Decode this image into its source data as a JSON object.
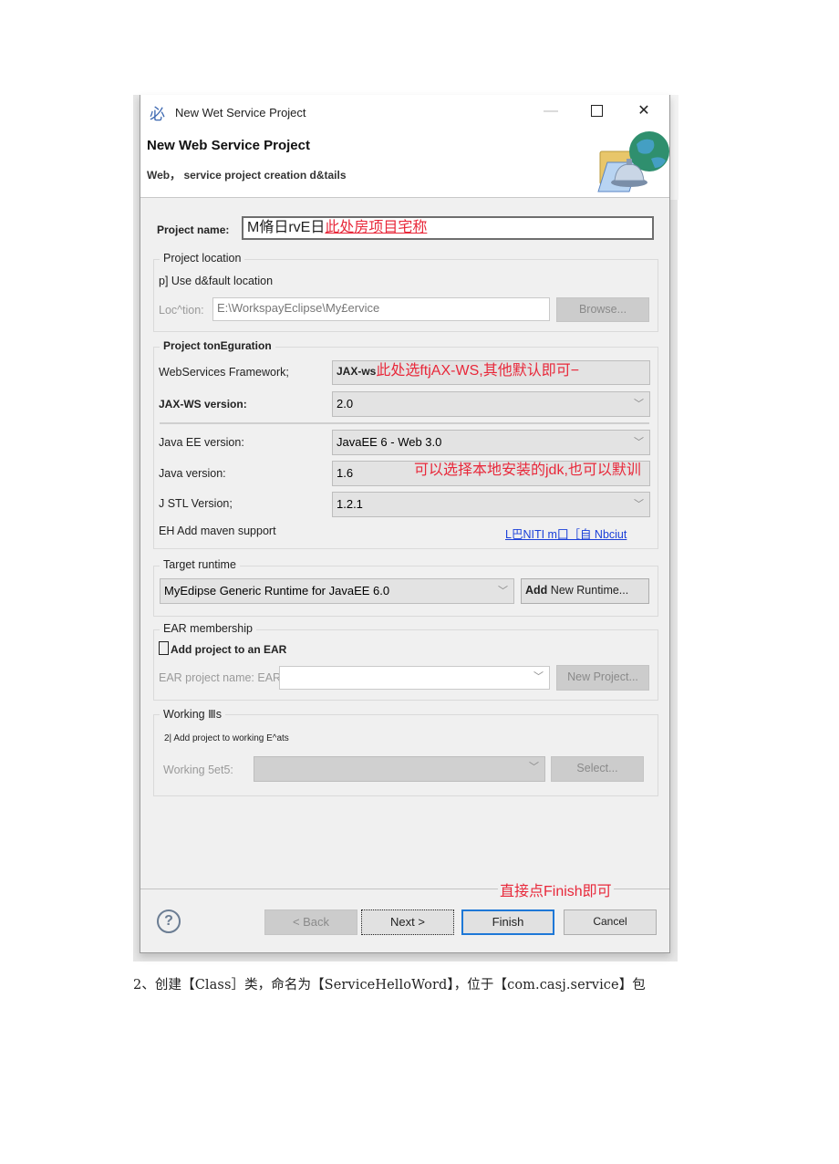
{
  "window": {
    "icon_glyph": "必",
    "title": "New Wet Service Project",
    "minimize_glyph": "—",
    "close_glyph": "✕"
  },
  "banner": {
    "title": "New Web Service Project",
    "subtitle": "Web， service project creation d&tails"
  },
  "project_name": {
    "label": "Project name: ",
    "value": "M脩日rvE日",
    "annotation": "此处房项目宅称"
  },
  "project_location": {
    "group_title": "Project location",
    "use_default_checkbox": "p] Use d&fault location",
    "location_label": "Loc^tion: ",
    "location_value": "E:\\WorkspayEclipse\\My£ervice",
    "browse_button": "Browse..."
  },
  "project_configuration": {
    "group_title": "Project tonEguration",
    "framework_label": "WebServices Framework;",
    "framework_value": "JAX-ws",
    "framework_annotation": "此处选ftjAX-WS,其他默认即可−",
    "jaxws_label": "JAX-WS version:",
    "jaxws_value": "2.0",
    "javaee_label": "Java EE version:",
    "javaee_value": "JavaEE 6 - Web 3.0",
    "java_label": "Java version:",
    "java_value": "1.6",
    "java_annotation": "可以选择本地安装的jdk,也可以默训",
    "jstl_label": "J STL Version;",
    "jstl_value": "1.2.1",
    "maven_label": "EH Add maven support",
    "maven_link": "L巴NITI m囗［自  Nbciut"
  },
  "target_runtime": {
    "group_title": "Target runtime",
    "runtime_value": "MyEdipse Generic Runtime for JavaEE 6.0",
    "add_runtime_button_bold": "Add",
    "add_runtime_button_rest": " New Runtime..."
  },
  "ear_membership": {
    "group_title": "EAR membership",
    "add_to_ear_checkbox": "Add project to an EAR",
    "ear_name_label": "EAR project name: EAR",
    "new_project_button": "New Project..."
  },
  "working_sets": {
    "group_title": "Working Ⅲs",
    "add_checkbox": "2| Add project to working E^ats",
    "working_sets_label": "Working 5et5:",
    "select_button": "Select..."
  },
  "footer": {
    "finish_annotation": "直接点Finish即可",
    "help_glyph": "?",
    "back_button": "< Back",
    "next_button": "Next >",
    "finish_button": "Finish",
    "cancel_button": "Cancel"
  },
  "caption": "2、创建【Class］类，命名为【ServiceHelloWord】，位于【com.casj.service】包"
}
